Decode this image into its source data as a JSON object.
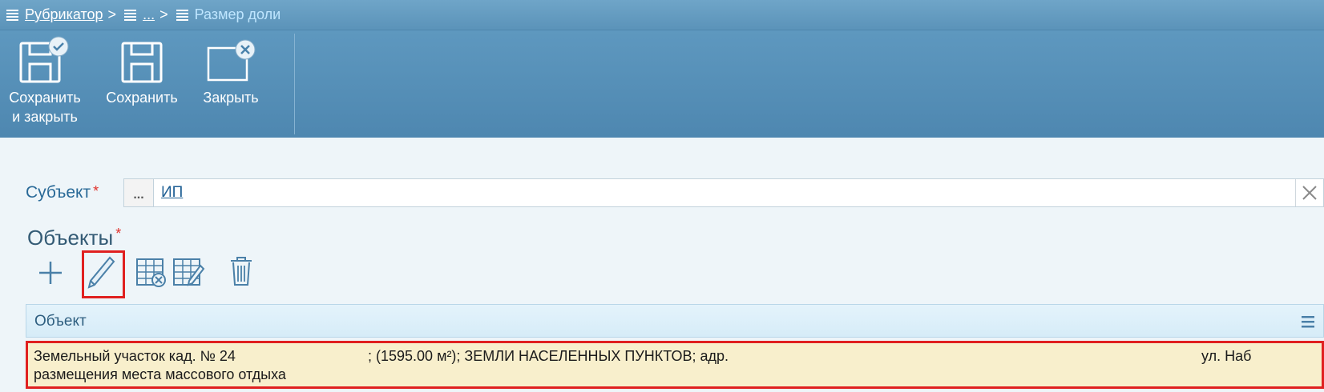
{
  "breadcrumb": {
    "root": "Рубрикатор",
    "middle": "...",
    "separator": ">",
    "current": "Размер доли"
  },
  "toolbar": {
    "save_close_line1": "Сохранить",
    "save_close_line2": "и закрыть",
    "save": "Сохранить",
    "close": "Закрыть"
  },
  "form": {
    "subject_label": "Субъект",
    "required_mark": "*",
    "subject_value": "ИП",
    "ellipsis": "...",
    "objects_title": "Объекты"
  },
  "grid": {
    "column_header": "Объект",
    "row": {
      "part1": "Земельный участок кад. № 24",
      "part2": "; (1595.00 м²); ЗЕМЛИ НАСЕЛЕННЫХ ПУНКТОВ; адр.",
      "part3": "ул. Наб",
      "line2": "размещения места массового отдыха"
    }
  },
  "icons": {
    "grid_tools": [
      "plus-icon",
      "pencil-icon",
      "grid-delete-icon",
      "grid-edit-icon",
      "trash-icon"
    ]
  },
  "colors": {
    "toolbar_bg": "#5b93b9",
    "highlight_border": "#e02020",
    "row_bg": "#f8efcc",
    "link": "#1f5f94"
  }
}
